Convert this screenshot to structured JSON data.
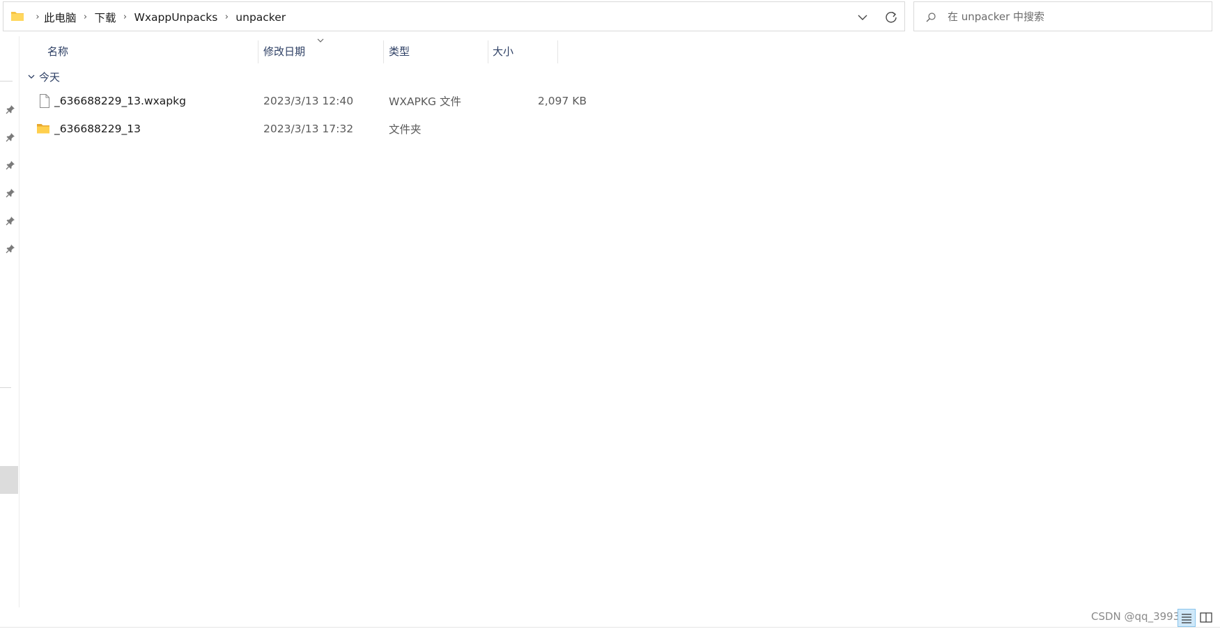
{
  "address": {
    "breadcrumbs": [
      "此电脑",
      "下载",
      "WxappUnpacks",
      "unpacker"
    ]
  },
  "search": {
    "placeholder": "在 unpacker 中搜索"
  },
  "columns": {
    "name": "名称",
    "date": "修改日期",
    "type": "类型",
    "size": "大小"
  },
  "group": {
    "label": "今天"
  },
  "files": [
    {
      "name": "_636688229_13.wxapkg",
      "date": "2023/3/13 12:40",
      "type": "WXAPKG 文件",
      "size": "2,097 KB",
      "icon": "file-icon"
    },
    {
      "name": "_636688229_13",
      "date": "2023/3/13 17:32",
      "type": "文件夹",
      "size": "",
      "icon": "folder-icon"
    }
  ],
  "watermark": "CSDN @qq_39934..."
}
